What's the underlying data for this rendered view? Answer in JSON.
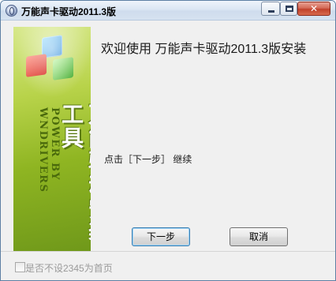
{
  "window": {
    "title": "万能声卡驱动2011.3版",
    "close_label": "✕"
  },
  "banner": {
    "title": "万能驱动安装工具",
    "subtitle": "POWER BY WNDRIVERS"
  },
  "main": {
    "welcome_text": "欢迎使用 万能声卡驱动2011.3版安装",
    "hint_text": "点击［下一步］ 继续"
  },
  "buttons": {
    "next_label": "下一步",
    "cancel_label": "取消"
  },
  "footer": {
    "checkbox_label": "是否不设2345为首页",
    "checkbox_checked": false
  },
  "colors": {
    "titlebar": "#dbe6f3",
    "banner_green": "#8fb522",
    "close_red": "#c0412b"
  }
}
